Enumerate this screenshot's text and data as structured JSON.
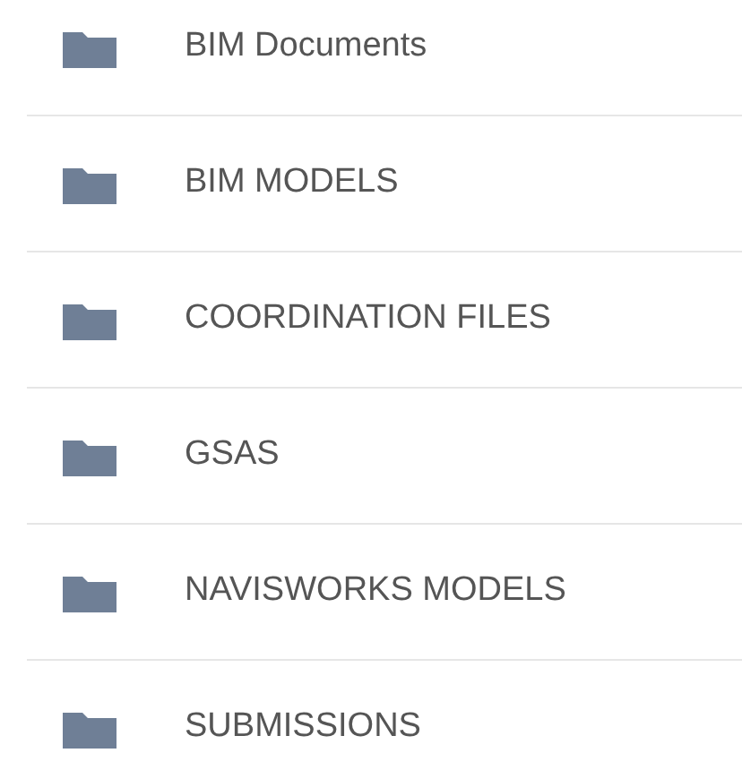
{
  "folders": [
    {
      "label": "BIM Documents"
    },
    {
      "label": "BIM MODELS"
    },
    {
      "label": "COORDINATION FILES"
    },
    {
      "label": "GSAS"
    },
    {
      "label": "NAVISWORKS MODELS"
    },
    {
      "label": "SUBMISSIONS"
    }
  ]
}
